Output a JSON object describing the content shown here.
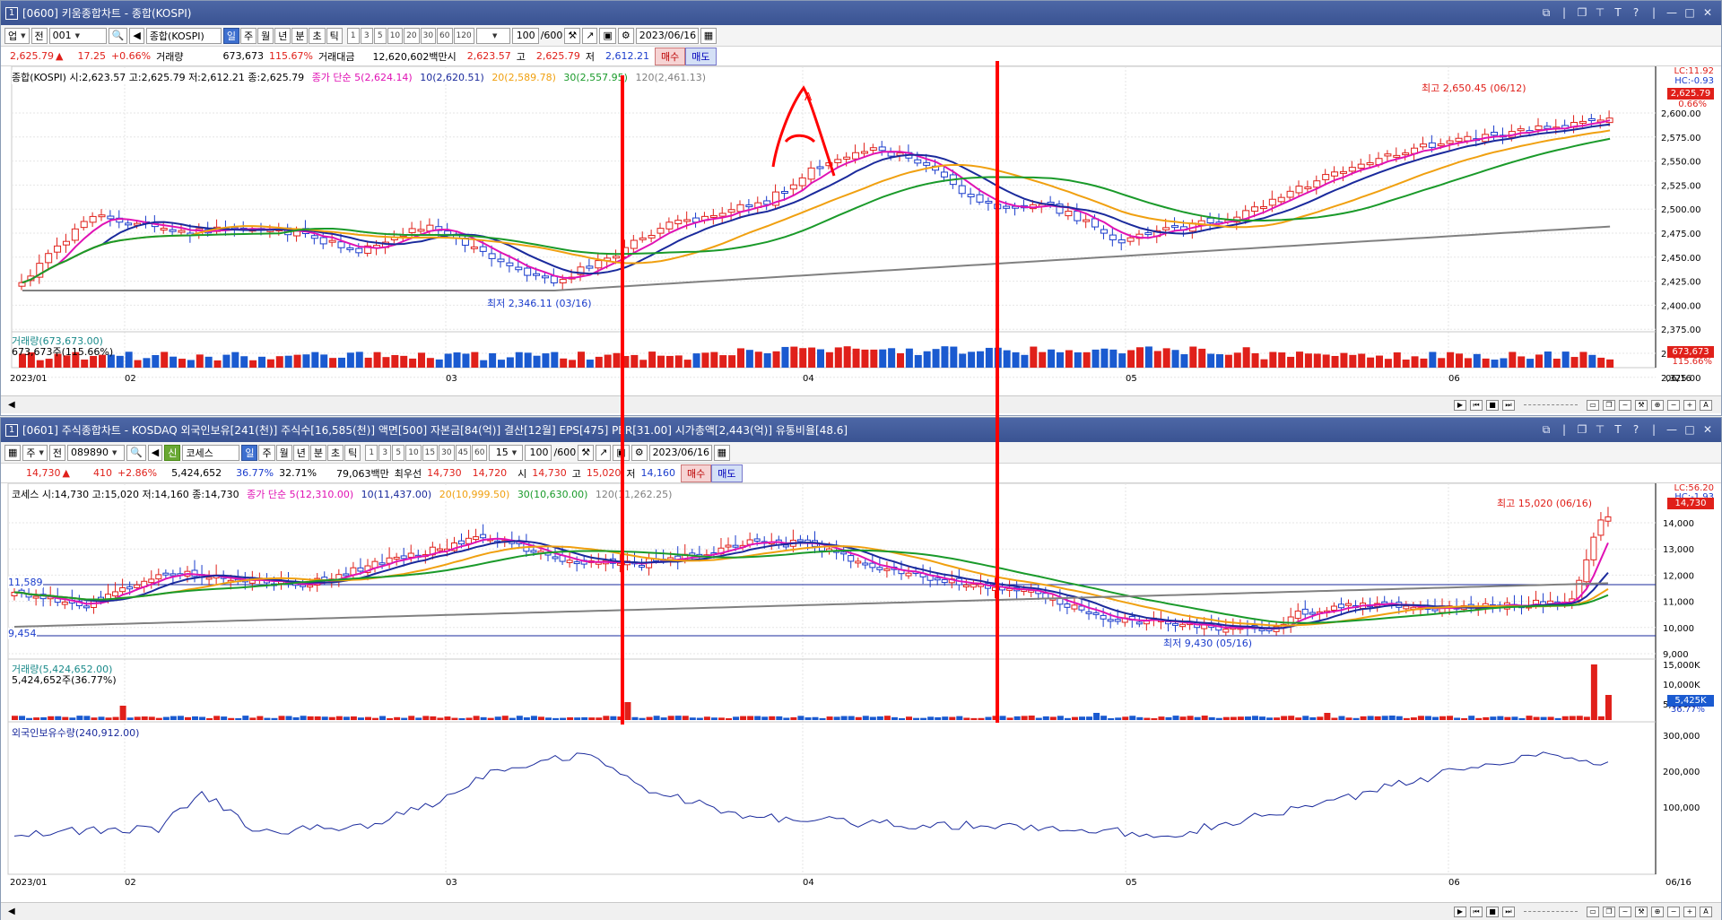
{
  "window1": {
    "number": "1",
    "title": "[0600] 키움종합차트 - 종합(KOSPI)",
    "toolbar": {
      "market": "업",
      "mode": "전",
      "code": "001",
      "name": "종합(KOSPI)",
      "periods": [
        "일",
        "주",
        "월",
        "년",
        "분",
        "초",
        "틱"
      ],
      "selected_period": "일",
      "intervals": [
        "1",
        "3",
        "5",
        "10",
        "20",
        "30",
        "60",
        "120"
      ],
      "count": "100",
      "max": "/600",
      "date": "2023/06/16"
    },
    "quote": {
      "price": "2,625.79",
      "arrow": "▲",
      "change": "17.25",
      "pct": "+0.66%",
      "vol_label": "거래량",
      "vol": "673,673",
      "vol_pct": "115.67%",
      "amt_label": "거래대금",
      "amt": "12,620,602백만",
      "open_label": "시",
      "open": "2,623.57",
      "high_label": "고",
      "high": "2,625.79",
      "low_label": "저",
      "low": "2,612.21",
      "buy": "매수",
      "sell": "매도"
    },
    "legend": {
      "main": "종합(KOSPI) 시:2,623.57 고:2,625.79 저:2,612.21 종:2,625.79",
      "ma5": "종가 단순 5(2,624.14)",
      "ma10": "10(2,620.51)",
      "ma20": "20(2,589.78)",
      "ma30": "30(2,557.95)",
      "ma120": "120(2,461.13)"
    },
    "right_info": {
      "lc": "LC:11.92",
      "hc": "HC:-0.93",
      "price_tag": "2,625.79",
      "pct_tag": "0.66%"
    },
    "yaxis": [
      "2,600.00",
      "2,575.00",
      "2,550.00",
      "2,525.00",
      "2,500.00",
      "2,475.00",
      "2,450.00",
      "2,425.00",
      "2,400.00",
      "2,375.00",
      "2,350.00",
      "2,325.00"
    ],
    "high_anno": "최고 2,650.45 (06/12)",
    "low_anno": "최저 2,346.11 (03/16)",
    "volume_label": "거래량(673,673.00)",
    "volume_sub": "673,673주(115.66%)",
    "volume_tag": "673,673",
    "volume_tag_pct": "115.66%",
    "xaxis": [
      "2023/01",
      "02",
      "03",
      "04",
      "05",
      "06"
    ],
    "xaxis_right": "06/16"
  },
  "window2": {
    "number": "1",
    "title": "[0601] 주식종합차트 - KOSDAQ 외국인보유[241(천)] 주식수[16,585(천)] 액면[500] 자본금[84(억)] 결산[12월] EPS[475] PER[31.00] 시가총액[2,443(억)] 유통비율[48.6]",
    "toolbar": {
      "market": "주",
      "mode": "전",
      "code": "089890",
      "name": "코세스",
      "badge": "신",
      "periods": [
        "일",
        "주",
        "월",
        "년",
        "분",
        "초",
        "틱"
      ],
      "selected_period": "일",
      "intervals": [
        "1",
        "3",
        "5",
        "10",
        "15",
        "30",
        "45",
        "60"
      ],
      "interval_select": "15",
      "count": "100",
      "max": "/600",
      "date": "2023/06/16"
    },
    "quote": {
      "price": "14,730",
      "arrow": "▲",
      "change": "410",
      "pct": "+2.86%",
      "vol": "5,424,652",
      "vol_pct": "36.77%",
      "turn": "32.71%",
      "amt": "79,063백만",
      "best_label": "최우선",
      "ask": "14,730",
      "bid": "14,720",
      "open_label": "시",
      "open": "14,730",
      "high_label": "고",
      "high": "15,020",
      "low_label": "저",
      "low": "14,160",
      "buy": "매수",
      "sell": "매도"
    },
    "legend": {
      "main": "코세스 시:14,730 고:15,020 저:14,160 종:14,730",
      "ma5": "종가 단순 5(12,310.00)",
      "ma10": "10(11,437.00)",
      "ma20": "20(10,999.50)",
      "ma30": "30(10,630.00)",
      "ma120": "120(11,262.25)"
    },
    "right_info": {
      "lc": "LC:56.20",
      "hc": "HC:-1.93",
      "pct": "2.86%",
      "price_tag": "14,730"
    },
    "yaxis": [
      "14,000",
      "13,000",
      "12,000",
      "11,000",
      "10,000",
      "9,000"
    ],
    "level_hi": "11,589",
    "level_lo": "9,454",
    "high_anno": "최고 15,020 (06/16)",
    "low_anno": "최저 9,430 (05/16)",
    "volume_label": "거래량(5,424,652.00)",
    "volume_sub": "5,424,652주(36.77%)",
    "volume_axis": [
      "15,000K",
      "10,000K",
      "5,000K"
    ],
    "volume_tag": "5,425K",
    "volume_tag_pct": "36.77%",
    "foreign_label": "외국인보유수량(240,912.00)",
    "foreign_axis": [
      "300,000",
      "200,000",
      "100,000"
    ],
    "xaxis": [
      "2023/01",
      "02",
      "03",
      "04",
      "05",
      "06"
    ],
    "xaxis_right": "06/16"
  },
  "colors": {
    "up": "#e0201a",
    "down": "#1a3ccc",
    "ma5": "#e012b4",
    "ma10": "#1a2a9c",
    "ma20": "#f0a010",
    "ma30": "#1a9a2a",
    "ma120": "#808080",
    "annotation": "#ff0000"
  },
  "annotation_text": "A"
}
